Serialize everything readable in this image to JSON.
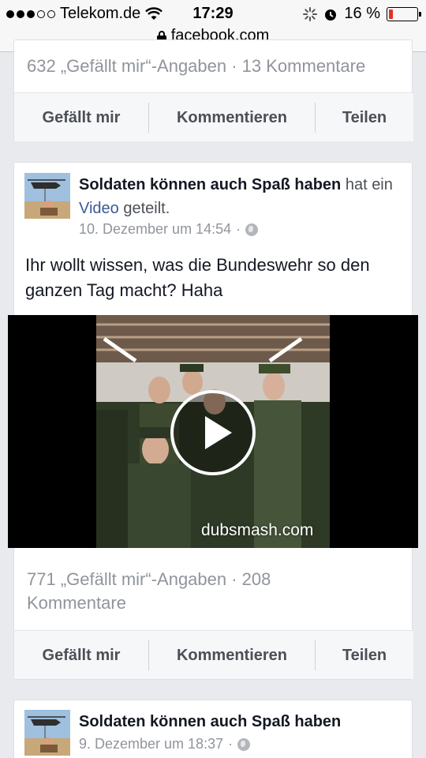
{
  "status_bar": {
    "carrier": "Telekom.de",
    "time": "17:29",
    "battery_text": "16 %",
    "battery_level": 0.16,
    "url": "facebook.com",
    "colors": {
      "battery_low": "#e0302a"
    }
  },
  "top_card": {
    "stats": "632 „Gefällt mir“-Angaben · 13 Kommentare",
    "actions": {
      "like": "Gefällt mir",
      "comment": "Kommentieren",
      "share": "Teilen"
    }
  },
  "post": {
    "page_name": "Soldaten können auch Spaß haben",
    "shared_prefix": "hat ein",
    "shared_link": "Video",
    "shared_suffix": "geteilt.",
    "timestamp": "10. Dezember um 14:54",
    "separator": "·",
    "text": "Ihr wollt wissen, was die Bundeswehr so den ganzen Tag macht? Haha",
    "video_watermark": "dubsmash.com",
    "stats_line1": "771 „Gefällt mir“-Angaben · 208",
    "stats_line2": "Kommentare",
    "actions": {
      "like": "Gefällt mir",
      "comment": "Kommentieren",
      "share": "Teilen"
    }
  },
  "next_post": {
    "page_name": "Soldaten können auch Spaß haben",
    "timestamp": "9. Dezember um 18:37",
    "separator": "·"
  },
  "icons": [
    "signal-dots-icon",
    "wifi-icon",
    "lock-icon",
    "activity-icon",
    "alarm-icon",
    "battery-icon",
    "globe-icon",
    "play-icon"
  ],
  "colors": {
    "link": "#3b5998",
    "background": "#e9eaed",
    "meta_text": "#90949c"
  }
}
